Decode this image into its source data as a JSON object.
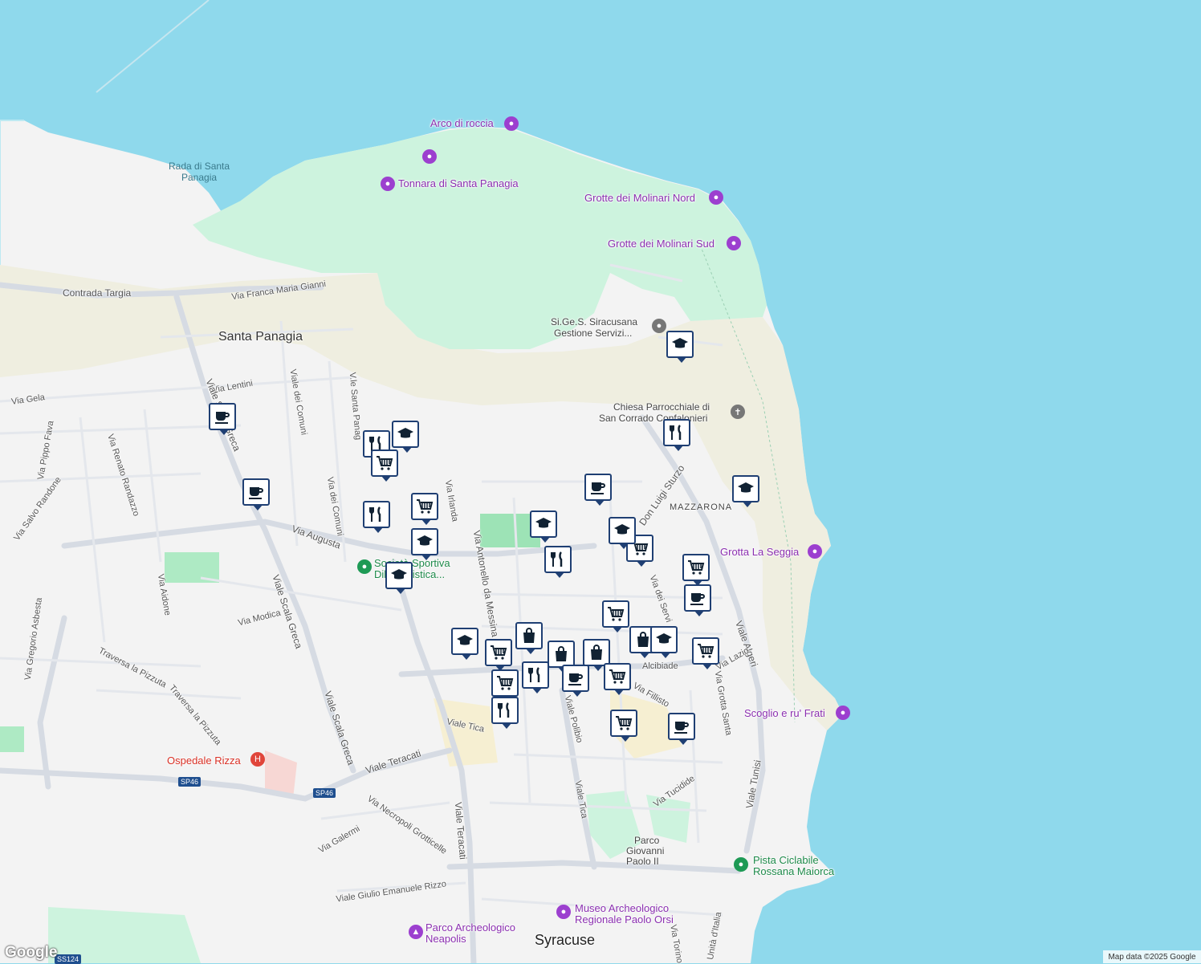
{
  "map": {
    "places": {
      "arco_di_roccia": "Arco di roccia",
      "rada": [
        "Rada di Santa",
        "Panagia"
      ],
      "tonnara": "Tonnara di Santa Panagia",
      "grotte_nord": "Grotte dei Molinari Nord",
      "grotte_sud": "Grotte dei Molinari Sud",
      "sigess": [
        "Si.Ge.S. Siracusana",
        "Gestione Servizi..."
      ],
      "chiesa": [
        "Chiesa Parrocchiale di",
        "San Corrado Confalonieri"
      ],
      "mazzarona": "MAZZARONA",
      "grotta_seggia": "Grotta La Seggia",
      "scoglio": "Scoglio e ru' Frati",
      "pista": [
        "Pista Ciclabile",
        "Rossana Maiorca"
      ],
      "museo": [
        "Museo Archeologico",
        "Regionale Paolo Orsi"
      ],
      "parco_giovanni": [
        "Parco",
        "Giovanni",
        "Paolo II"
      ],
      "parco_neapolis": [
        "Parco Archeologico",
        "Neapolis"
      ],
      "ospedale": "Ospedale Rizza",
      "societa": [
        "Società Sportiva",
        "Dilettantistica..."
      ],
      "santa_panagia": "Santa Panagia",
      "syracuse": "Syracuse"
    },
    "roads": {
      "contrada_targia": "Contrada Targia",
      "franca_maria_gianni": "Via Franca Maria Gianni",
      "via_lentini": "Via Lentini",
      "via_gela": "Via Gela",
      "viale_dei_comuni": "Viale dei Comuni",
      "via_dei_comuni": "Via dei Comuni",
      "vle_santa_panagia": "V.le Santa Panag",
      "viale_scala_greca_1": "Viale Scala Greca",
      "viale_scala_greca_2": "Viale Scala Greca",
      "viale_scala_greca_3": "Viale Scala Greca",
      "via_augusta": "Via Augusta",
      "via_irlanda": "Via Irlanda",
      "via_antonello": "Via Antonello da Messina",
      "via_pippo_fava": "Via Pippo Fava",
      "via_renato_randazzo": "Via Renato Randazzo",
      "via_salvo_randone": "Via Salvo Randone",
      "via_aidone": "Via Aidone",
      "via_modica": "Via Modica",
      "via_gregorio": "Via Gregorio Asbesta",
      "traversa_pizzuta_1": "Traversa la Pizzuta",
      "traversa_pizzuta_2": "Traversa la Pizzuta",
      "viale_teracati_1": "Viale Teracati",
      "viale_teracati_2": "Viale Teracati",
      "viale_tica_1": "Viale Tica",
      "viale_tica_2": "Viale Tica",
      "viale_polibio": "Viale Polibio",
      "via_necropoli": "Via Necropoli Grotticelle",
      "via_galermi": "Via Galermi",
      "viale_giulio": "Viale Giulio Emanuele Rizzo",
      "via_tucidide": "Via Tucidide",
      "viale_tunisi": "Viale Tunisi",
      "viale_algeri": "Viale Algeri",
      "via_grotta_santa": "Via Grotta Santa",
      "via_lazio": "Via Lazio",
      "via_fillisto": "Via Fillisto",
      "don_luigi_sturzo": "Don Luigi Sturzo",
      "via_alcibiade": "Alcibiade",
      "via_dei_servi": "Via dei Servi",
      "via_torino": "Via Torino",
      "unita_italia": "Unità d'Italia",
      "sp46_a": "SP46",
      "sp46_b": "SP46",
      "ss124": "SS124"
    },
    "attribution": "Map data ©2025 Google",
    "logo": "Google"
  },
  "markers": [
    {
      "icon": "coffee-icon"
    },
    {
      "icon": "coffee-icon"
    },
    {
      "icon": "restaurant-icon"
    },
    {
      "icon": "school-icon"
    },
    {
      "icon": "cart-icon"
    },
    {
      "icon": "restaurant-icon"
    },
    {
      "icon": "cart-icon"
    },
    {
      "icon": "school-icon"
    },
    {
      "icon": "school-icon"
    },
    {
      "icon": "school-icon"
    },
    {
      "icon": "restaurant-icon"
    },
    {
      "icon": "coffee-icon"
    },
    {
      "icon": "school-icon"
    },
    {
      "icon": "cart-icon"
    },
    {
      "icon": "school-icon"
    },
    {
      "icon": "restaurant-icon"
    },
    {
      "icon": "school-icon"
    },
    {
      "icon": "cart-icon"
    },
    {
      "icon": "coffee-icon"
    },
    {
      "icon": "cart-icon"
    },
    {
      "icon": "shopping-bag-icon"
    },
    {
      "icon": "school-icon"
    },
    {
      "icon": "cart-icon"
    },
    {
      "icon": "cart-icon"
    },
    {
      "icon": "restaurant-icon"
    },
    {
      "icon": "restaurant-icon"
    },
    {
      "icon": "shopping-bag-icon"
    },
    {
      "icon": "coffee-icon"
    },
    {
      "icon": "shopping-bag-icon"
    },
    {
      "icon": "cart-icon"
    },
    {
      "icon": "shopping-bag-icon"
    },
    {
      "icon": "school-icon"
    },
    {
      "icon": "cart-icon"
    },
    {
      "icon": "cart-icon"
    },
    {
      "icon": "coffee-icon"
    }
  ],
  "colors": {
    "sea": "#8fd9ec",
    "land": "#f3f3f3",
    "park": "#cdf3de",
    "sand": "#efeee0",
    "marker_border": "#1f3f73"
  }
}
